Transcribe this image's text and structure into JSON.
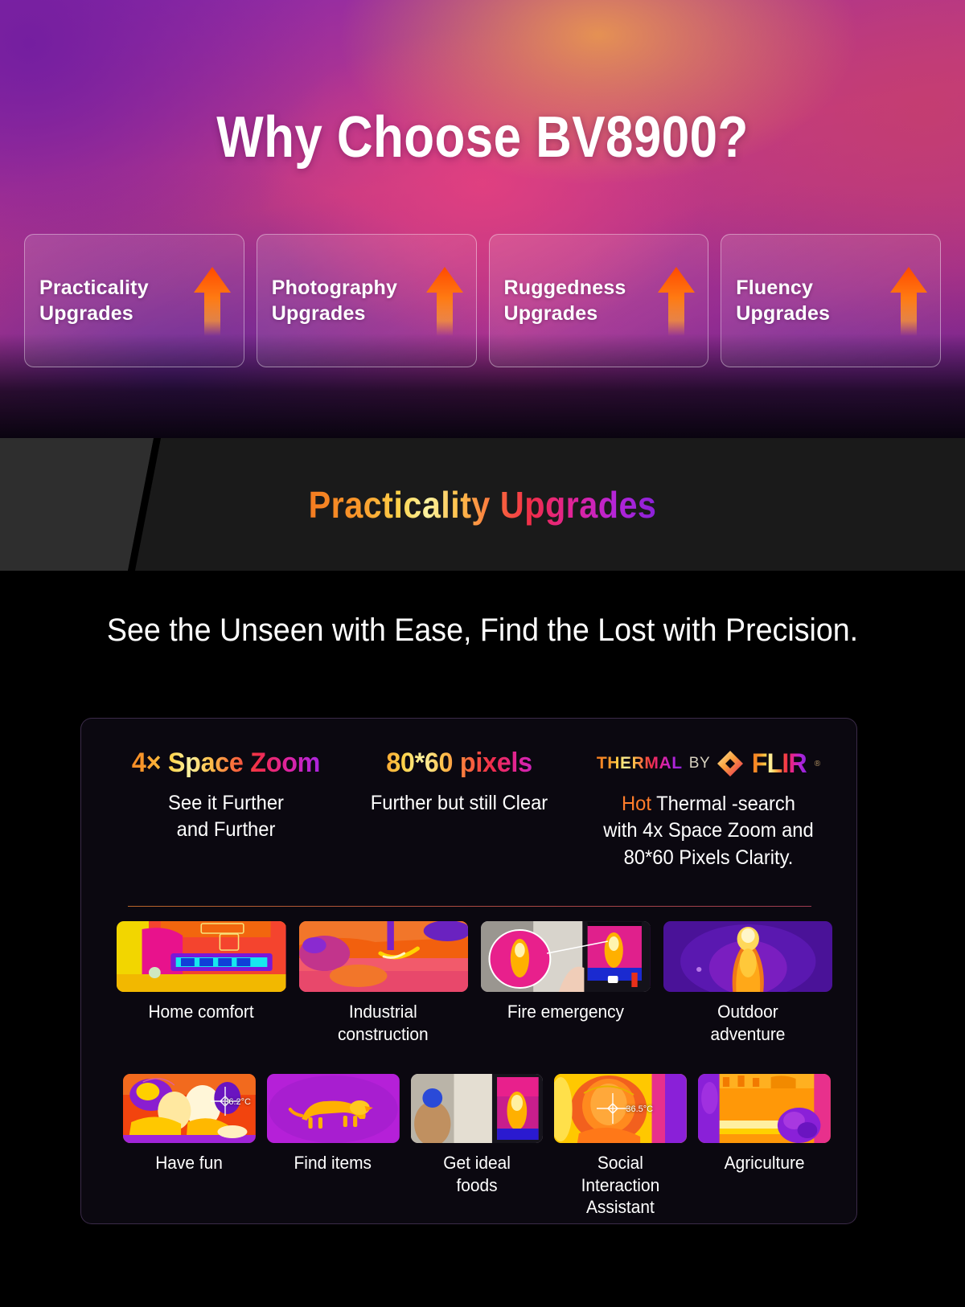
{
  "hero": {
    "title": "Why Choose BV8900?",
    "cards": [
      {
        "label": "Practicality\nUpgrades",
        "icon": "arrow-up-icon"
      },
      {
        "label": "Photography\nUpgrades",
        "icon": "arrow-up-icon"
      },
      {
        "label": "Ruggedness\nUpgrades",
        "icon": "arrow-up-icon"
      },
      {
        "label": "Fluency\nUpgrades",
        "icon": "arrow-up-icon"
      }
    ]
  },
  "section": {
    "band_title": "Practicality Upgrades",
    "subtitle": "See the Unseen with Ease, Find the Lost with Precision."
  },
  "panel": {
    "features": [
      {
        "heading": "4× Space Zoom",
        "desc": "See it Further\nand Further"
      },
      {
        "heading": "80*60 pixels",
        "desc": "Further but still Clear"
      },
      {
        "logo": {
          "thermal": "THERMAL",
          "by": "BY",
          "brand": "FLIR",
          "registered": "®",
          "diamond_icon": "flir-diamond-icon"
        },
        "hot_word": "Hot",
        "desc_line1": " Thermal -search",
        "desc_line2": "with 4x Space Zoom and",
        "desc_line3": "80*60 Pixels Clarity."
      }
    ],
    "row1": [
      {
        "label": "Home comfort"
      },
      {
        "label": "Industrial\nconstruction"
      },
      {
        "label": "Fire emergency"
      },
      {
        "label": "Outdoor\nadventure"
      }
    ],
    "row2": [
      {
        "label": "Have fun",
        "temp": "36.2°C"
      },
      {
        "label": "Find items",
        "temp": ""
      },
      {
        "label": "Get ideal\nfoods",
        "temp": ""
      },
      {
        "label": "Social Interaction\nAssistant",
        "temp": "36.5°C"
      },
      {
        "label": "Agriculture",
        "temp": ""
      }
    ]
  },
  "colors": {
    "accent_orange": "#ff7d2b",
    "arrow_orange": "#ff5a0a",
    "panel_bg": "#0b0810",
    "band_bg": "#1a1a1a",
    "band_slab": "#2e2e2e"
  }
}
